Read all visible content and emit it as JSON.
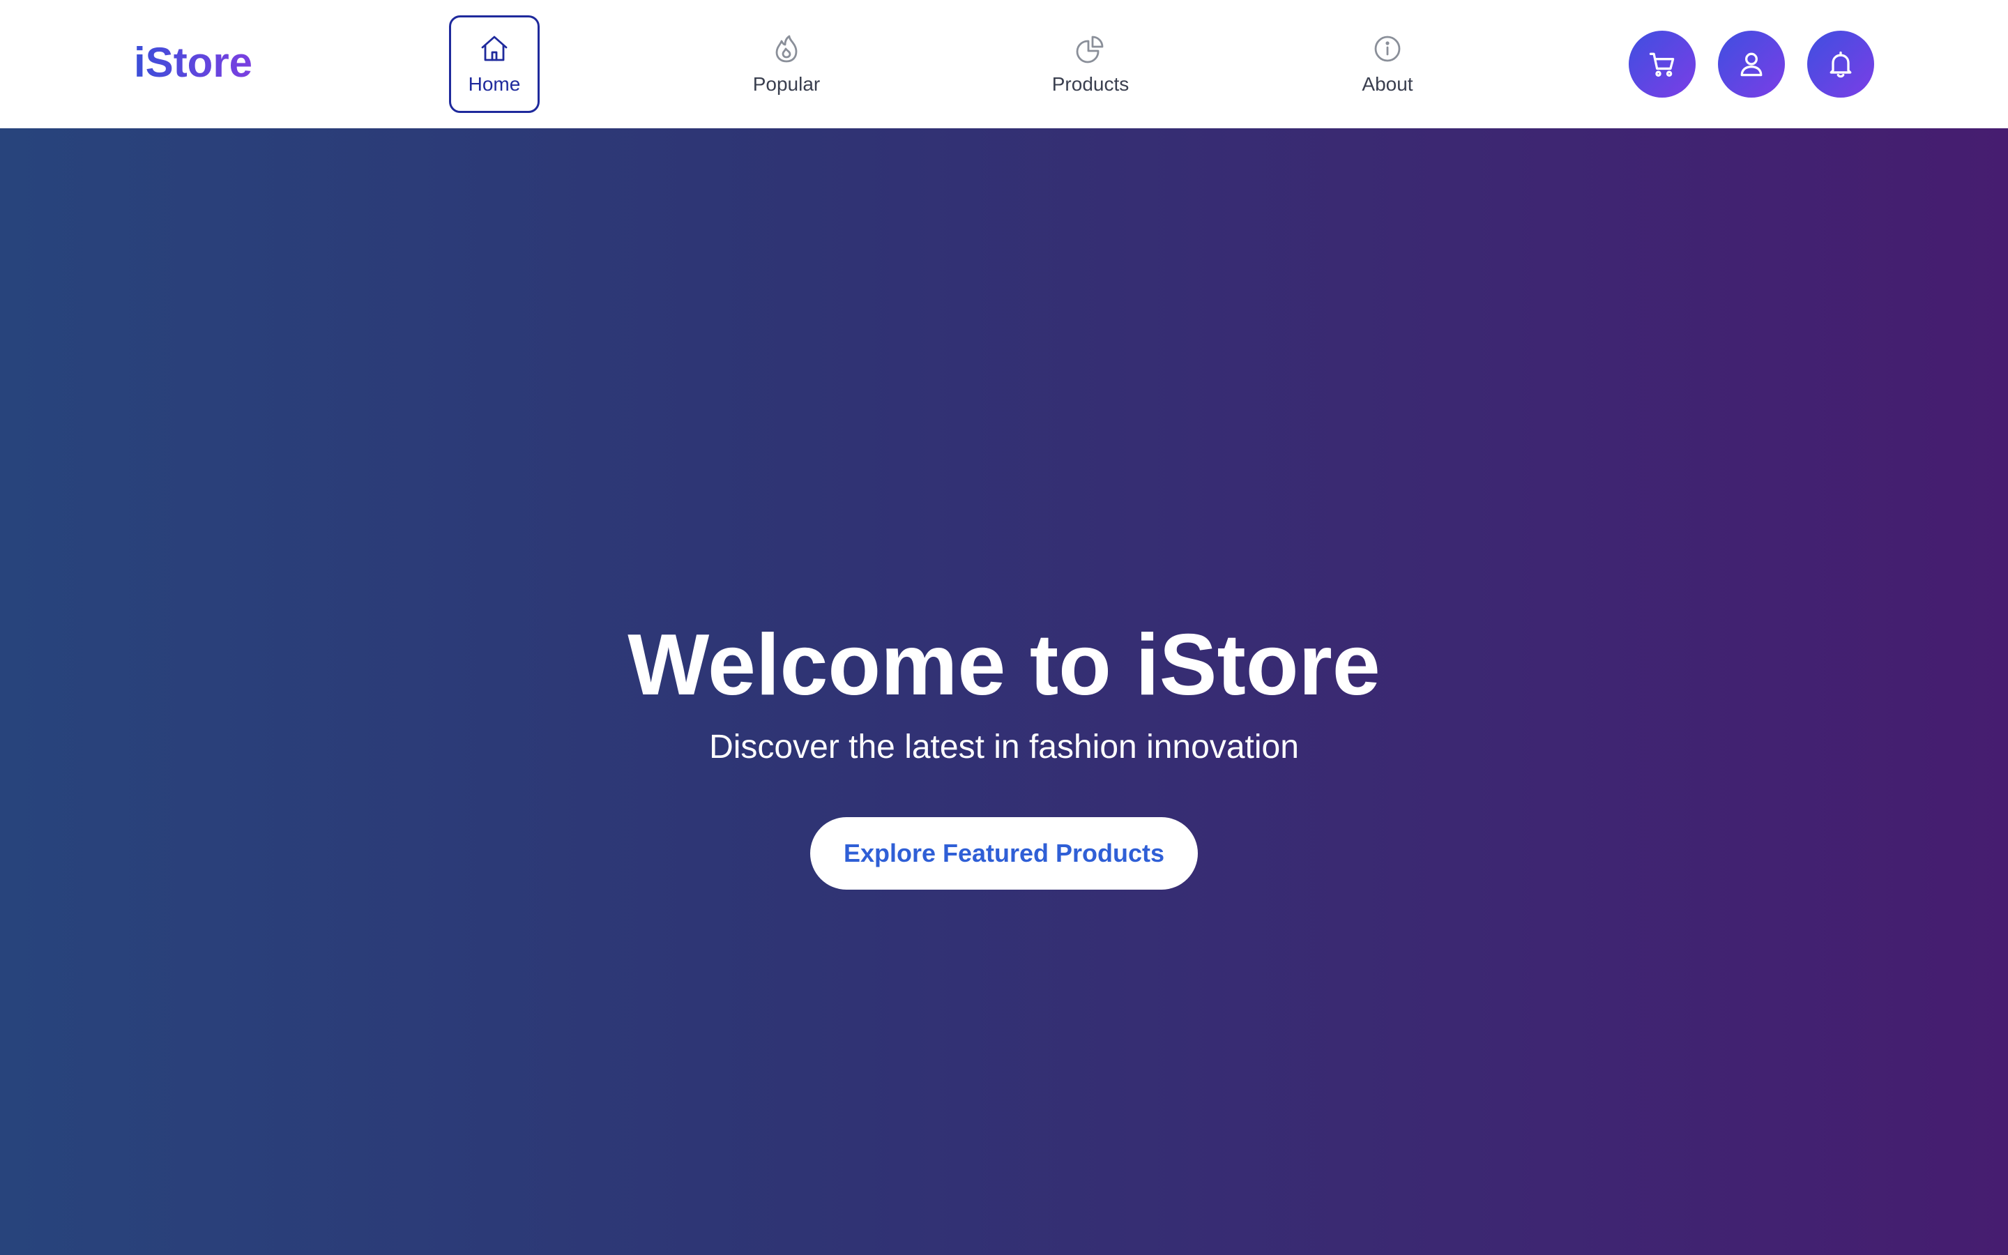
{
  "brand": {
    "name": "iStore"
  },
  "nav": {
    "items": [
      {
        "label": "Home",
        "icon": "home-icon",
        "active": true
      },
      {
        "label": "Popular",
        "icon": "fire-icon",
        "active": false
      },
      {
        "label": "Products",
        "icon": "pie-chart-icon",
        "active": false
      },
      {
        "label": "About",
        "icon": "info-icon",
        "active": false
      }
    ]
  },
  "actions": [
    {
      "icon": "cart-icon"
    },
    {
      "icon": "user-icon"
    },
    {
      "icon": "bell-icon"
    }
  ],
  "hero": {
    "title": "Welcome to iStore",
    "subtitle": "Discover the latest in fashion innovation",
    "cta_label": "Explore Featured Products"
  },
  "colors": {
    "brand_gradient_start": "#3b4fd8",
    "brand_gradient_end": "#7b3fe0",
    "active_nav": "#1f2a9c",
    "hero_gradient_start": "#28447c",
    "hero_gradient_end": "#461d70",
    "cta_text": "#2f5fd6"
  }
}
